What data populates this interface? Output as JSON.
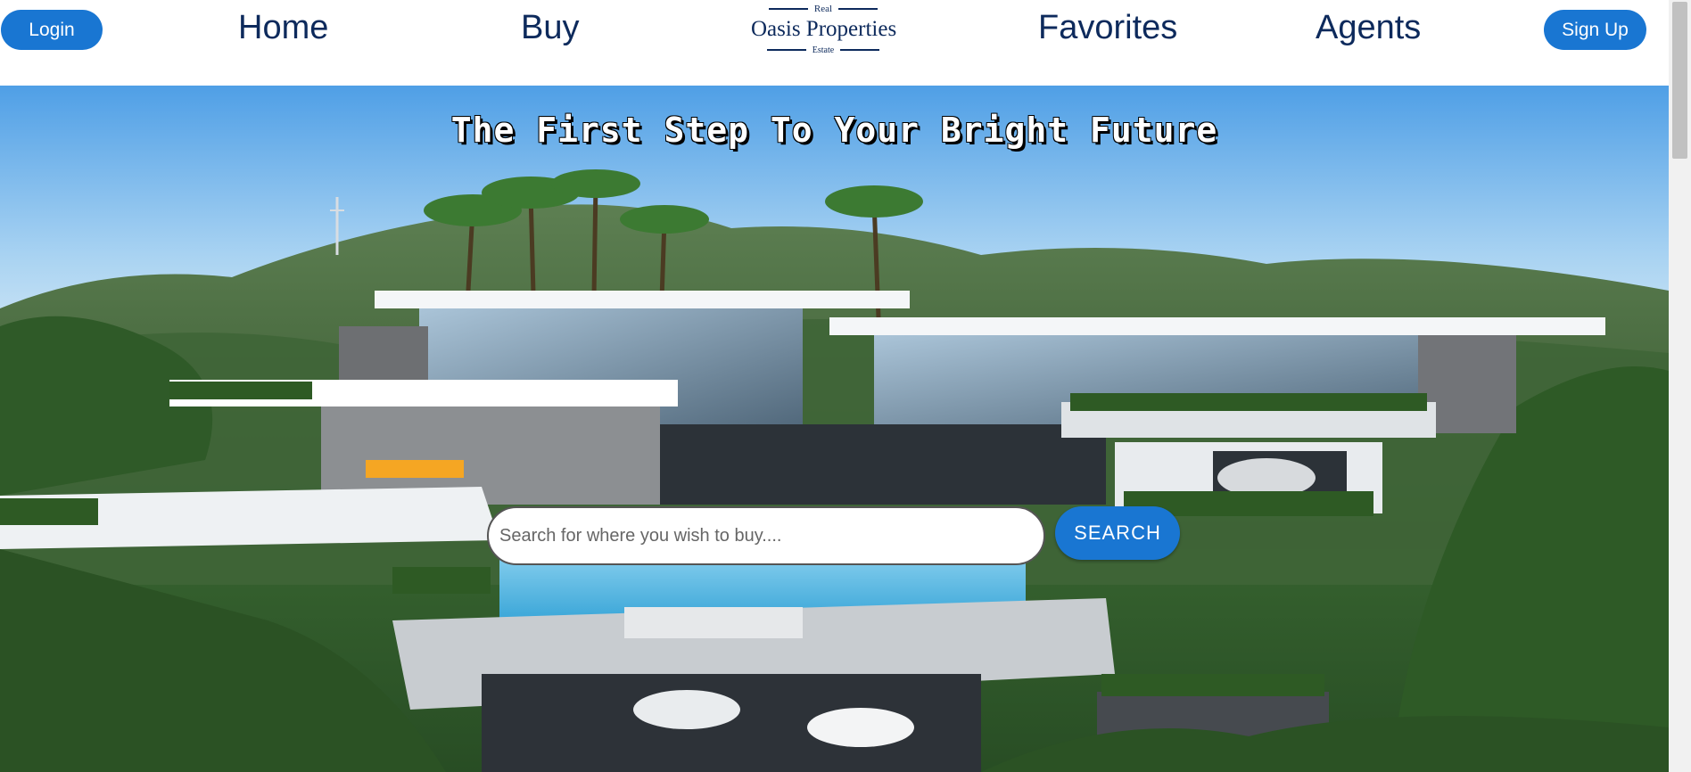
{
  "nav": {
    "login_label": "Login",
    "signup_label": "Sign Up",
    "links": [
      "Home",
      "Buy",
      "Favorites",
      "Agents"
    ],
    "logo": {
      "top_text": "Real",
      "main_text": "Oasis Properties",
      "bottom_text": "Estate"
    }
  },
  "hero": {
    "headline": "The First Step To Your Bright Future",
    "search": {
      "value": "",
      "placeholder": "Search for where you wish to buy....",
      "button_label": "SEARCH"
    }
  },
  "colors": {
    "accent": "#1976d2",
    "nav_text": "#0d2a5c"
  }
}
